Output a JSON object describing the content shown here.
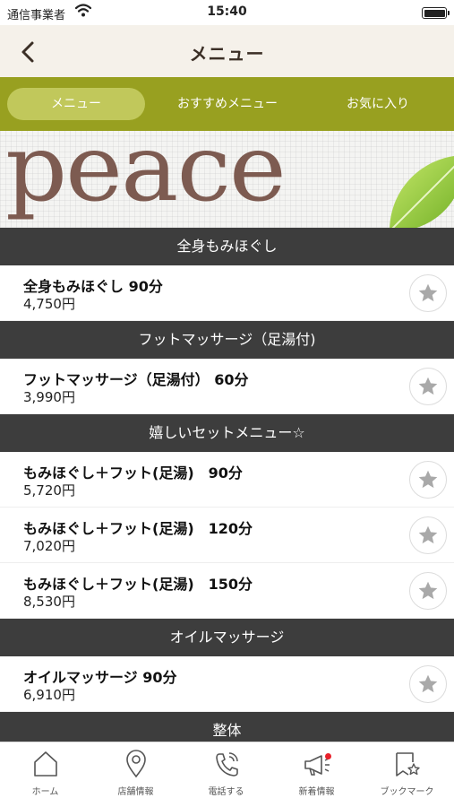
{
  "status_bar": {
    "carrier": "通信事業者",
    "time": "15:40"
  },
  "nav": {
    "title": "メニュー",
    "back_icon": "chevron-left-icon"
  },
  "tabs": [
    {
      "label": "メニュー",
      "active": true
    },
    {
      "label": "おすすめメニュー",
      "active": false
    },
    {
      "label": "お気に入り",
      "active": false
    }
  ],
  "banner": {
    "text": "peace"
  },
  "sections": [
    {
      "title": "全身もみほぐし",
      "items": [
        {
          "name": "全身もみほぐし 90分",
          "price": "4,750円"
        }
      ]
    },
    {
      "title": "フットマッサージ（足湯付)",
      "items": [
        {
          "name": "フットマッサージ（足湯付） 60分",
          "price": "3,990円"
        }
      ]
    },
    {
      "title": "嬉しいセットメニュー☆",
      "items": [
        {
          "name": "もみほぐし＋フット(足湯)　90分",
          "price": "5,720円"
        },
        {
          "name": "もみほぐし＋フット(足湯)　120分",
          "price": "7,020円"
        },
        {
          "name": "もみほぐし＋フット(足湯)　150分",
          "price": "8,530円"
        }
      ]
    },
    {
      "title": "オイルマッサージ",
      "items": [
        {
          "name": "オイルマッサージ 90分",
          "price": "6,910円"
        }
      ]
    },
    {
      "title": "整体",
      "items": []
    }
  ],
  "tab_bar": [
    {
      "label": "ホーム",
      "icon": "home-icon"
    },
    {
      "label": "店舗情報",
      "icon": "map-pin-icon"
    },
    {
      "label": "電話する",
      "icon": "phone-icon"
    },
    {
      "label": "新着情報",
      "icon": "megaphone-icon",
      "badge": true
    },
    {
      "label": "ブックマーク",
      "icon": "bookmark-star-icon"
    }
  ],
  "colors": {
    "tab_bar_green": "#98a020",
    "active_tab": "#c1c85b",
    "section_header": "#3d3d3d",
    "nav_background": "#f5f1ea",
    "badge": "#e8202a"
  }
}
